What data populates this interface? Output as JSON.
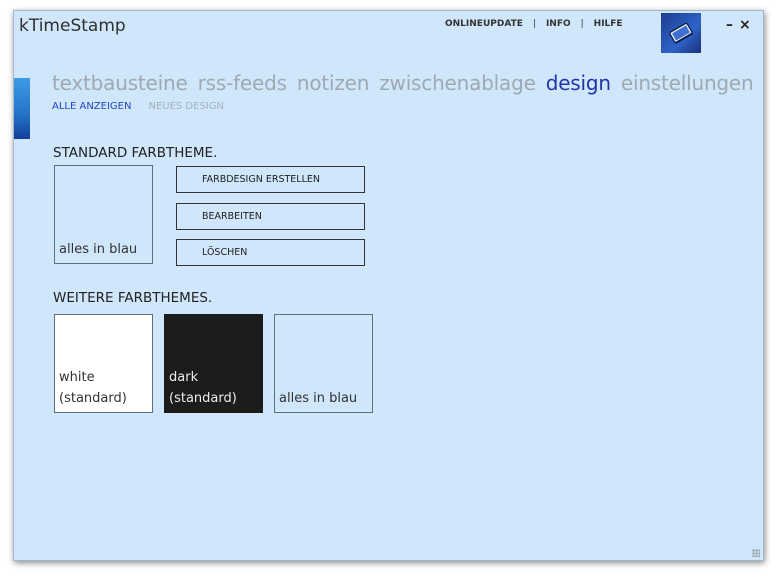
{
  "app": {
    "title": "kTimeStamp"
  },
  "topmenu": {
    "items": [
      "ONLINEUPDATE",
      "INFO",
      "HILFE"
    ],
    "separator": "|"
  },
  "window_controls": {
    "minimize": "–",
    "close": "×"
  },
  "tabs": {
    "items": [
      "textbausteine",
      "rss-feeds",
      "notizen",
      "zwischenablage",
      "design",
      "einstellungen"
    ],
    "active": "design"
  },
  "subtabs": {
    "items": [
      "ALLE ANZEIGEN",
      "NEUES DESIGN"
    ],
    "active": "ALLE ANZEIGEN"
  },
  "standard": {
    "title": "STANDARD FARBTHEME.",
    "tile_label": "alles in blau",
    "buttons": [
      "FARBDESIGN ERSTELLEN",
      "BEARBEITEN",
      "LÖSCHEN"
    ]
  },
  "weitere": {
    "title": "WEITERE FARBTHEMES.",
    "tiles": [
      {
        "line1": "white",
        "line2": "(standard)",
        "color": "#ffffff"
      },
      {
        "line1": "dark",
        "line2": "(standard)",
        "color": "#1c1c1c"
      },
      {
        "line1": "alles in blau",
        "line2": "",
        "color": "#cfe6fb"
      }
    ]
  },
  "colors": {
    "background": "#cfe6fb",
    "accent": "#2233aa",
    "inactive_tab": "#9fa9b1"
  }
}
